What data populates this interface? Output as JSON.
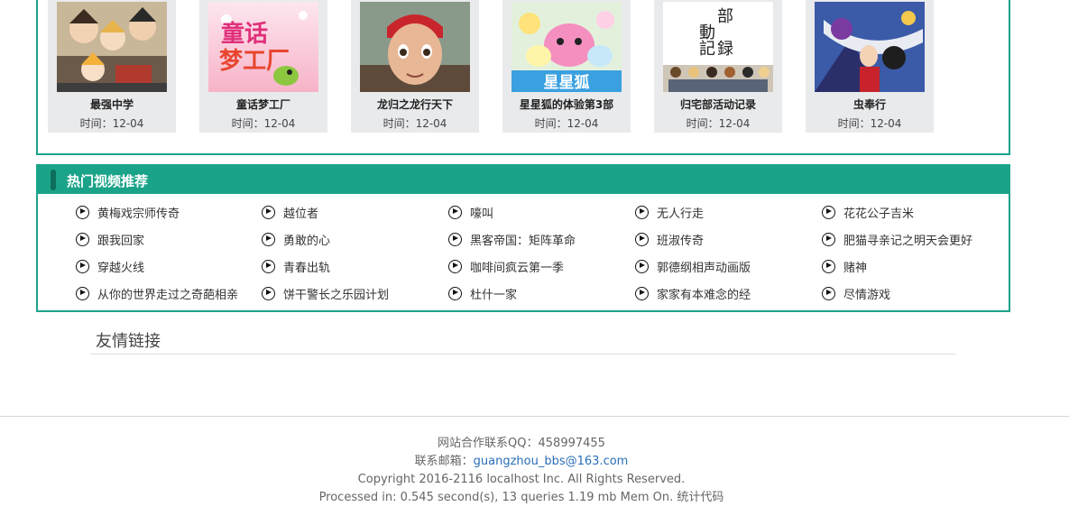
{
  "movies": [
    {
      "title": "最强中学",
      "time": "时间：12-04"
    },
    {
      "title": "童话梦工厂",
      "time": "时间：12-04",
      "poster_text": "童话梦工厂"
    },
    {
      "title": "龙归之龙行天下",
      "time": "时间：12-04"
    },
    {
      "title": "星星狐的体验第3部",
      "time": "时间：12-04",
      "poster_text": "星星狐"
    },
    {
      "title": "归宅部活动记录",
      "time": "时间：12-04",
      "poster_text": "部 動記録"
    },
    {
      "title": "虫奉行",
      "time": "时间：12-04"
    }
  ],
  "hot": {
    "title": "热门视频推荐",
    "columns": [
      [
        "黄梅戏宗师传奇",
        "跟我回家",
        "穿越火线",
        "从你的世界走过之奇葩相亲"
      ],
      [
        "越位者",
        "勇敢的心",
        "青春出轨",
        "饼干警长之乐园计划"
      ],
      [
        "嚎叫",
        "黑客帝国：矩阵革命",
        "咖啡间疯云第一季",
        "杜什一家"
      ],
      [
        "无人行走",
        "班淑传奇",
        "郭德纲相声动画版",
        "家家有本难念的经"
      ],
      [
        "花花公子吉米",
        "肥猫寻亲记之明天会更好",
        "赌神",
        "尽情游戏"
      ]
    ]
  },
  "links": {
    "title": "友情链接"
  },
  "footer": {
    "qq": "网站合作联系QQ：458997455",
    "mail_label": "联系邮箱：",
    "mail": "guangzhou_bbs@163.com",
    "copyright": "Copyright 2016-2116 localhost Inc. All Rights Reserved.",
    "processed": "Processed in: 0.545 second(s), 13 queries 1.19 mb Mem On. 统计代码"
  },
  "colors": {
    "accent": "#1ba389",
    "link": "#2a6fb7"
  }
}
